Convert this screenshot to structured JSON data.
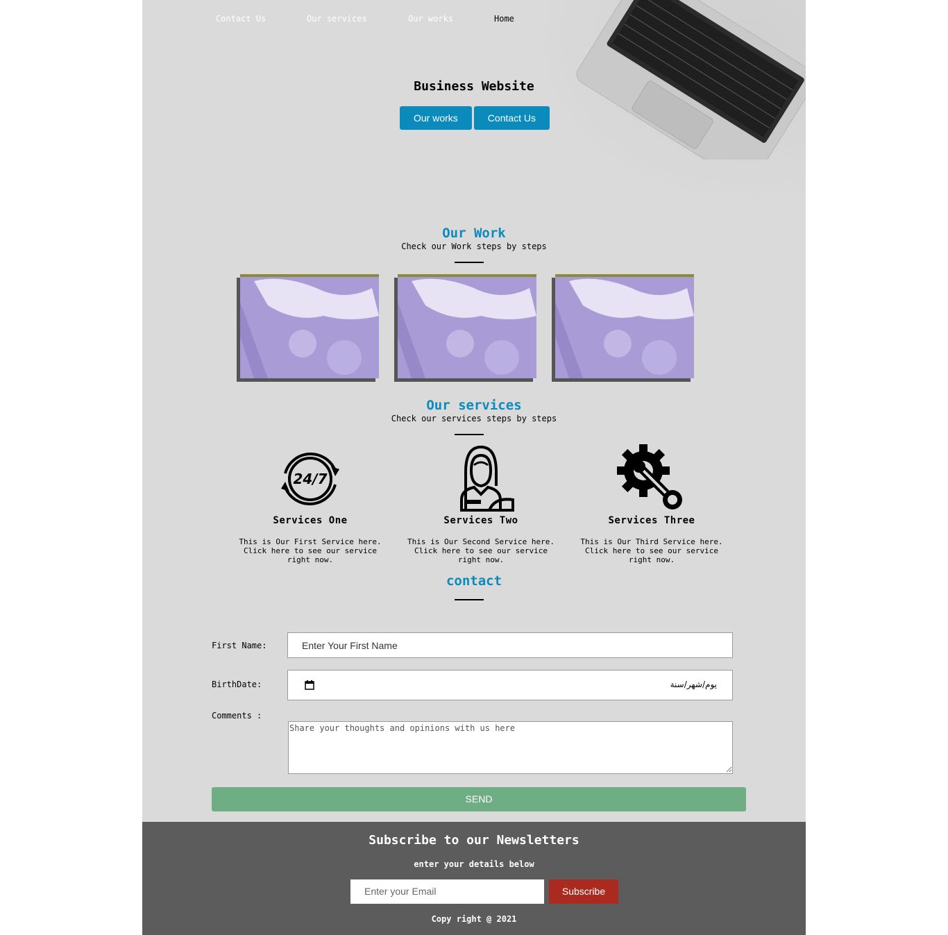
{
  "nav": {
    "links": [
      "Contact Us",
      "Our services",
      "Our works",
      "Home"
    ],
    "active": "Home"
  },
  "hero": {
    "title": "Business Website",
    "buttons": [
      "Our works",
      "Contact Us"
    ]
  },
  "work": {
    "title": "Our Work",
    "subtitle": "Check our Work steps by steps"
  },
  "services": {
    "title": "Our services",
    "subtitle": "Check our services steps by steps",
    "items": [
      {
        "name": "Services One",
        "icon": "24-7-icon",
        "desc": "This is Our First Service here. Click here to see our service right now."
      },
      {
        "name": "Services Two",
        "icon": "support-person-icon",
        "desc": "This is Our Second Service here. Click here to see our service right now."
      },
      {
        "name": "Services Three",
        "icon": "gear-wrench-icon",
        "desc": "This is Our Third Service here. Click here to see our service right now."
      }
    ]
  },
  "contact": {
    "title": "contact",
    "first_name_label": "First Name:",
    "first_name_placeholder": "Enter Your First Name",
    "birthdate_label": "BirthDate:",
    "birthdate_placeholder": "يوم/شهر/سنة",
    "comments_label": "Comments :",
    "comments_placeholder": "Share your thoughts and opinions with us here",
    "send_label": "SEND"
  },
  "footer": {
    "title": "Subscribe to our Newsletters",
    "subtitle": "enter your details below",
    "email_placeholder": "Enter your Email",
    "subscribe_label": "Subscribe",
    "copyright": "Copy right @ 2021"
  },
  "colors": {
    "accent": "#0b8bbb",
    "send": "#6fae85",
    "subscribe": "#aa2a1f",
    "footer_bg": "#5c5c5c",
    "page_bg": "#dadada"
  }
}
